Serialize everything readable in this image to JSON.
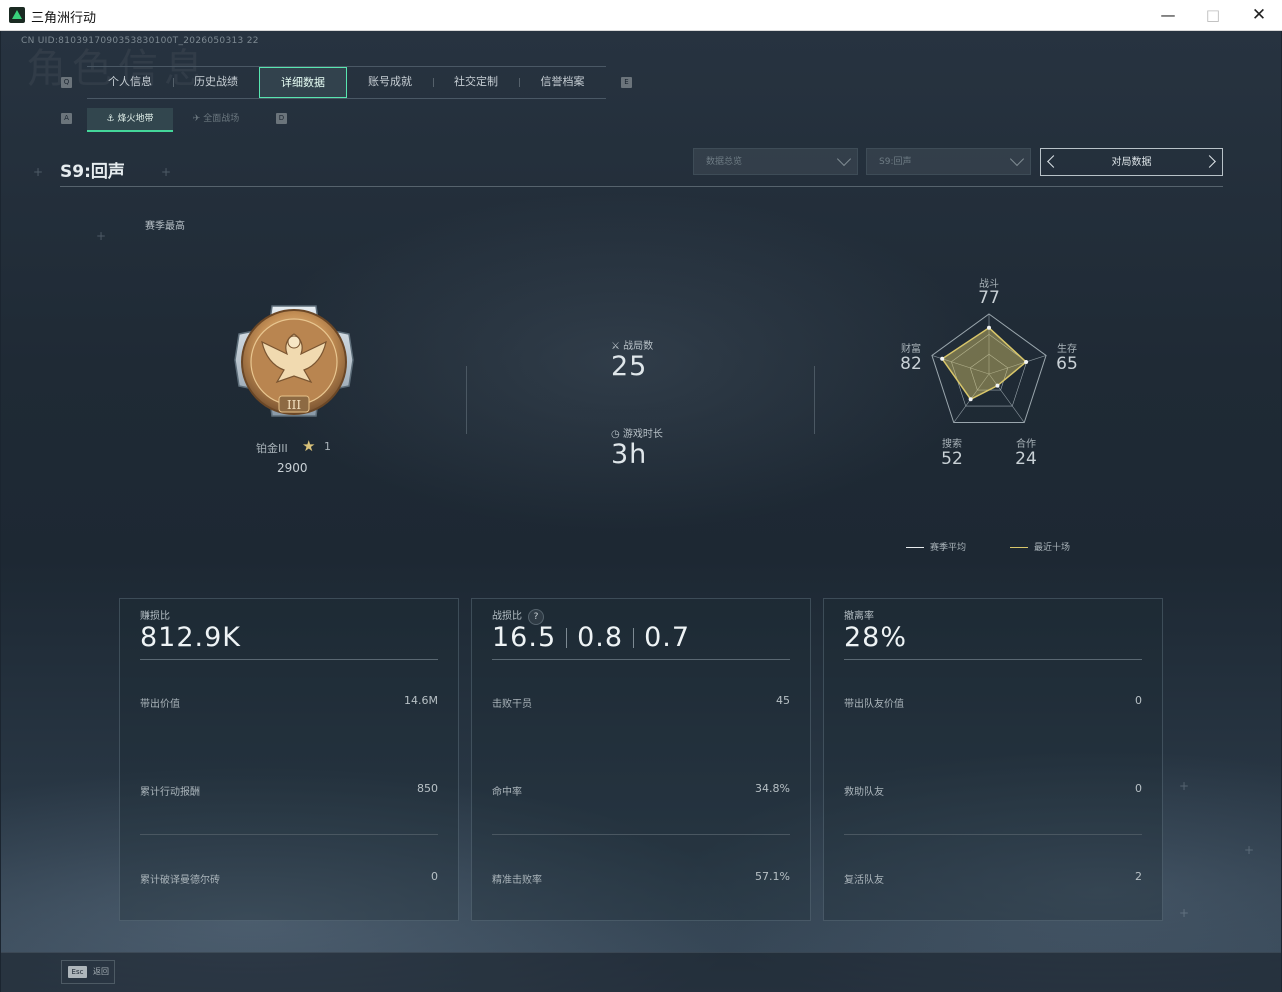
{
  "window": {
    "title": "三角洲行动"
  },
  "uid": "CN UID:8103917090353830100T_2026050313 22",
  "watermark": "角色信息",
  "nav": {
    "key_left": "Q",
    "key_right": "E",
    "tabs": [
      "个人信息",
      "历史战绩",
      "详细数据",
      "账号成就",
      "社交定制",
      "信誉档案"
    ],
    "active_tab": "详细数据"
  },
  "subnav": {
    "key_left": "A",
    "key_right": "D",
    "tabs": [
      "烽火地带",
      "全面战场"
    ]
  },
  "season_title": "S9:回声",
  "filters": {
    "dropdown1": "数据总览",
    "dropdown2": "S9:回声",
    "match_label": "对局数据"
  },
  "season_best": "赛季最高",
  "rank": {
    "name": "铂金III",
    "stars": "1",
    "score": "2900",
    "emblem_numeral": "III"
  },
  "stats": {
    "matches_label": "战局数",
    "matches_value": "25",
    "playtime_label": "游戏时长",
    "playtime_value": "3h"
  },
  "radar": {
    "axes": [
      {
        "label": "战斗",
        "value": "77"
      },
      {
        "label": "生存",
        "value": "65"
      },
      {
        "label": "合作",
        "value": "24"
      },
      {
        "label": "搜索",
        "value": "52"
      },
      {
        "label": "财富",
        "value": "82"
      }
    ],
    "values": [
      77,
      65,
      24,
      52,
      82
    ],
    "legend": [
      {
        "label": "赛季平均",
        "color": "#e8ecee"
      },
      {
        "label": "最近十场",
        "color": "#d8c66a"
      }
    ]
  },
  "cards": [
    {
      "header": "赚损比",
      "big": "812.9K",
      "rows": [
        {
          "label": "带出价值",
          "value": "14.6M"
        },
        {
          "label": "累计行动报酬",
          "value": "850"
        },
        {
          "label": "累计破译曼德尔砖",
          "value": "0"
        }
      ]
    },
    {
      "header": "战损比",
      "help": "?",
      "big_parts": [
        "16.5",
        "0.8",
        "0.7"
      ],
      "rows": [
        {
          "label": "击败干员",
          "value": "45"
        },
        {
          "label": "命中率",
          "value": "34.8%"
        },
        {
          "label": "精准击败率",
          "value": "57.1%"
        }
      ]
    },
    {
      "header": "撤离率",
      "big": "28%",
      "rows": [
        {
          "label": "带出队友价值",
          "value": "0"
        },
        {
          "label": "救助队友",
          "value": "0"
        },
        {
          "label": "复活队友",
          "value": "2"
        }
      ]
    }
  ],
  "bottom": {
    "esc_key": "Esc",
    "esc_label": "返回"
  },
  "colors": {
    "accent": "#44d69a",
    "radar_fill": "#d8c66a",
    "background": "#1d2833"
  }
}
